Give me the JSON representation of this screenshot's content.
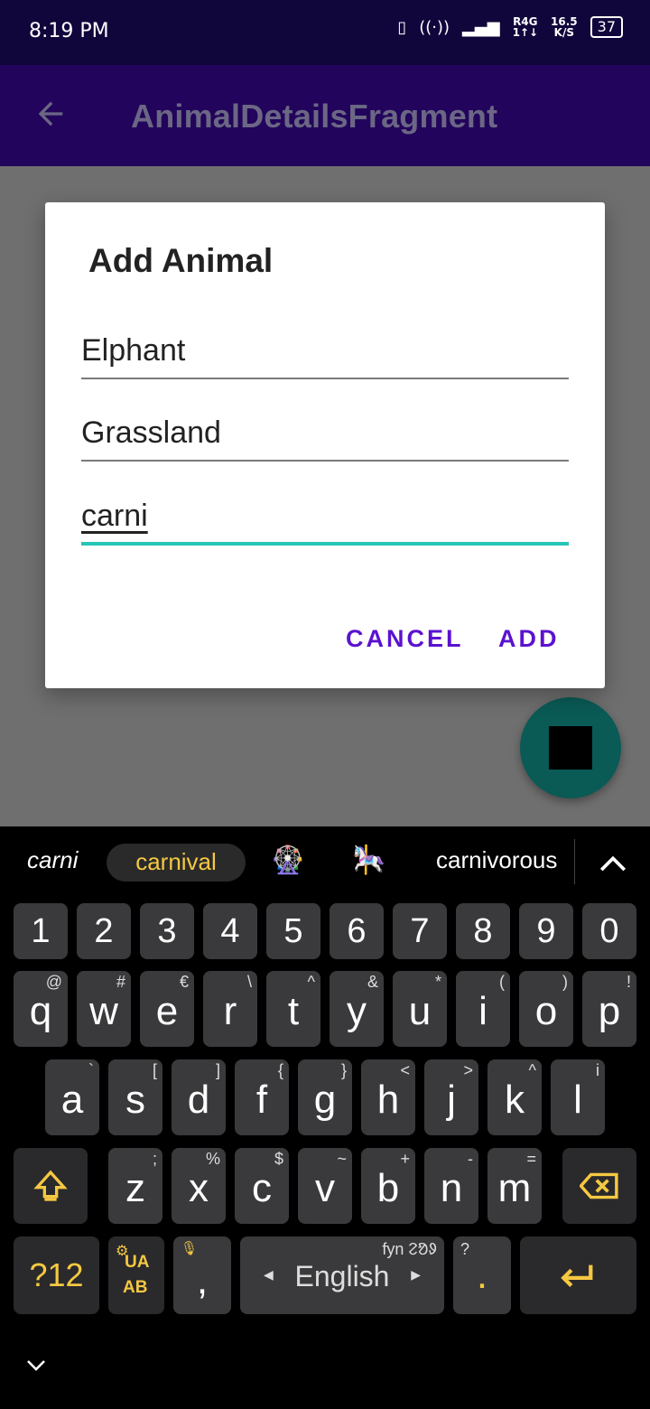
{
  "status": {
    "time": "8:19 PM",
    "network_top": "R4G",
    "network_bottom": "1↑↓",
    "speed_value": "16.5",
    "speed_unit": "K/S",
    "battery": "37"
  },
  "appbar": {
    "title": "AnimalDetailsFragment",
    "back_icon": "arrow-back-icon"
  },
  "dialog": {
    "title": "Add Animal",
    "fields": [
      {
        "value": "Elphant"
      },
      {
        "value": "Grassland"
      },
      {
        "value": "carni"
      }
    ],
    "cancel_label": "CANCEL",
    "add_label": "ADD",
    "accent_color": "#26c6b5",
    "button_color": "#5b12cf"
  },
  "fab": {
    "icon": "stop-square-icon",
    "color": "#0a5a55"
  },
  "keyboard": {
    "suggestions": {
      "typed": "carni",
      "highlighted": "carnival",
      "emoji1": "🎡",
      "emoji2": "🎠",
      "word": "carnivorous"
    },
    "digits": [
      "1",
      "2",
      "3",
      "4",
      "5",
      "6",
      "7",
      "8",
      "9",
      "0"
    ],
    "row1": [
      {
        "k": "q",
        "a": "@"
      },
      {
        "k": "w",
        "a": "#"
      },
      {
        "k": "e",
        "a": "€"
      },
      {
        "k": "r",
        "a": "\\"
      },
      {
        "k": "t",
        "a": "^"
      },
      {
        "k": "y",
        "a": "&"
      },
      {
        "k": "u",
        "a": "*"
      },
      {
        "k": "i",
        "a": "("
      },
      {
        "k": "o",
        "a": ")"
      },
      {
        "k": "p",
        "a": "!"
      }
    ],
    "row2": [
      {
        "k": "a",
        "a": "`"
      },
      {
        "k": "s",
        "a": "["
      },
      {
        "k": "d",
        "a": "]"
      },
      {
        "k": "f",
        "a": "{"
      },
      {
        "k": "g",
        "a": "}"
      },
      {
        "k": "h",
        "a": "<"
      },
      {
        "k": "j",
        "a": ">"
      },
      {
        "k": "k",
        "a": "^"
      },
      {
        "k": "l",
        "a": "i"
      }
    ],
    "row3": [
      {
        "k": "z",
        "a": ";"
      },
      {
        "k": "x",
        "a": "%"
      },
      {
        "k": "c",
        "a": "$"
      },
      {
        "k": "v",
        "a": "~"
      },
      {
        "k": "b",
        "a": "+"
      },
      {
        "k": "n",
        "a": "-"
      },
      {
        "k": "m",
        "a": "="
      }
    ],
    "symbols_label": "?12",
    "lang_switch_top": "UA",
    "lang_switch_bottom": "AB",
    "comma": ",",
    "space_label": "English",
    "space_hint": "fyn ᱮᱚᱽ",
    "period": ".",
    "period_alt": "?",
    "accent_color": "#f5c842"
  }
}
